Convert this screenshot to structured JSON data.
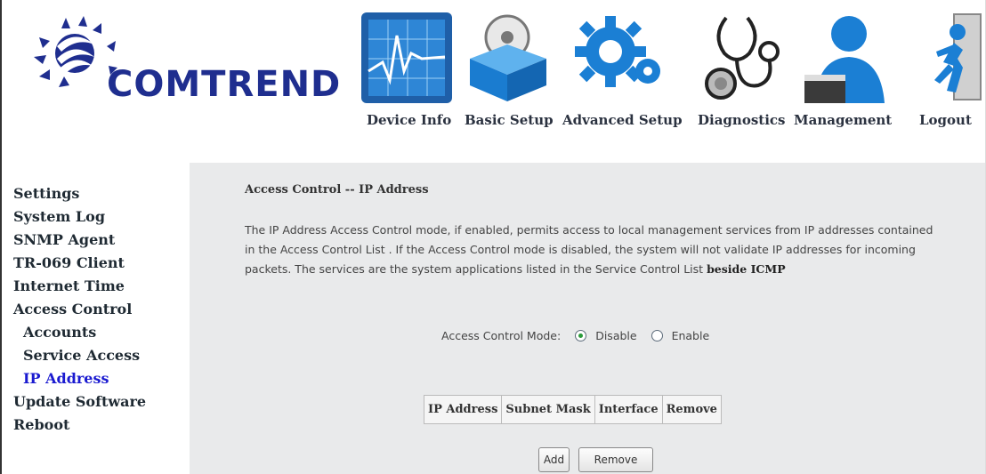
{
  "brand": {
    "logo_text": "COMTREND"
  },
  "nav": [
    {
      "label": "Device Info",
      "icon": "device-info-icon"
    },
    {
      "label": "Basic Setup",
      "icon": "basic-setup-icon"
    },
    {
      "label": "Advanced Setup",
      "icon": "advanced-setup-icon"
    },
    {
      "label": "Diagnostics",
      "icon": "diagnostics-icon"
    },
    {
      "label": "Management",
      "icon": "management-icon"
    },
    {
      "label": "Logout",
      "icon": "logout-icon"
    }
  ],
  "sidebar": {
    "items": [
      {
        "label": "Settings"
      },
      {
        "label": "System Log"
      },
      {
        "label": "SNMP Agent"
      },
      {
        "label": "TR-069 Client"
      },
      {
        "label": "Internet Time"
      },
      {
        "label": "Access Control"
      },
      {
        "label": "Accounts"
      },
      {
        "label": "Service Access"
      },
      {
        "label": "IP Address"
      },
      {
        "label": "Update Software"
      },
      {
        "label": "Reboot"
      }
    ]
  },
  "main": {
    "title": "Access Control -- IP Address",
    "description": "The IP Address Access Control mode, if enabled, permits access to local management services from IP addresses contained in the Access Control List . If the Access Control mode is disabled, the system will not validate IP addresses for incoming packets. The services are the system applications listed in the Service Control List",
    "description_bold": "beside ICMP",
    "mode_label": "Access Control Mode:",
    "options": [
      {
        "label": "Disable",
        "selected": true
      },
      {
        "label": "Enable",
        "selected": false
      }
    ],
    "table_headers": [
      "IP Address",
      "Subnet Mask",
      "Interface",
      "Remove"
    ],
    "buttons": {
      "add": "Add",
      "remove": "Remove"
    }
  },
  "colors": {
    "brand_blue": "#1f2e8f",
    "active_link": "#1a1ad0",
    "content_bg": "#e9eaeb",
    "icon_blue": "#1b7fd4"
  }
}
